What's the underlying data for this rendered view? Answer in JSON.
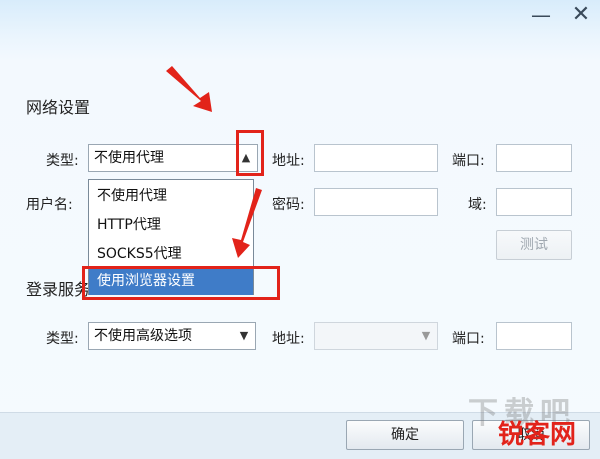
{
  "window": {
    "minimize_glyph": "—",
    "close_glyph": "✕"
  },
  "network": {
    "title": "网络设置",
    "type_label": "类型:",
    "type_value": "不使用代理",
    "address_label": "地址:",
    "port_label": "端口:",
    "username_label": "用户名:",
    "password_label": "密码:",
    "domain_label": "域:",
    "test_button": "测试",
    "dropdown_options": [
      "不使用代理",
      "HTTP代理",
      "SOCKS5代理",
      "使用浏览器设置"
    ],
    "selected_option_index": 3
  },
  "login_server": {
    "title": "登录服务",
    "type_label": "类型:",
    "type_value": "不使用高级选项",
    "address_label": "地址:",
    "port_label": "端口:"
  },
  "footer": {
    "ok_button": "确定",
    "cancel_button": "取消"
  },
  "watermark": {
    "text1": "下载吧",
    "text2": "锐客网"
  },
  "colors": {
    "accent_red": "#e2231a",
    "selection_blue": "#3f7cc8"
  }
}
